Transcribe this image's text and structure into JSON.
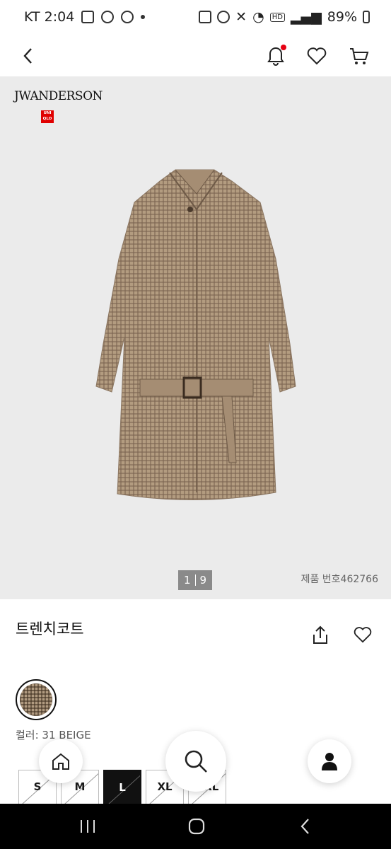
{
  "status": {
    "carrier_time": "KT 2:04",
    "hd": "HD",
    "battery": "89%"
  },
  "header": {
    "back_icon": "chevron-left-icon",
    "bell_icon": "bell-icon",
    "notification_dot_color": "#e60012",
    "wishlist_icon": "heart-icon",
    "cart_icon": "cart-icon"
  },
  "product": {
    "brand": "JWANDERSON",
    "logo_text": "UNI QLO",
    "image_counter": {
      "current": "1",
      "total": "9"
    },
    "product_number": "제품 번호462766",
    "name": "트렌치코트",
    "color_label": "컬러: 31 BEIGE",
    "sizes": [
      {
        "label": "S",
        "selected": false
      },
      {
        "label": "M",
        "selected": false
      },
      {
        "label": "L",
        "selected": true
      },
      {
        "label": "XL",
        "selected": false
      },
      {
        "label": "XXL",
        "selected": false
      }
    ]
  },
  "fabs": {
    "home_icon": "home-icon",
    "search_icon": "search-icon",
    "profile_icon": "person-icon"
  },
  "system_nav": {
    "recents_icon": "recents-icon",
    "home_icon": "home-circle-icon",
    "back_icon": "back-icon"
  }
}
